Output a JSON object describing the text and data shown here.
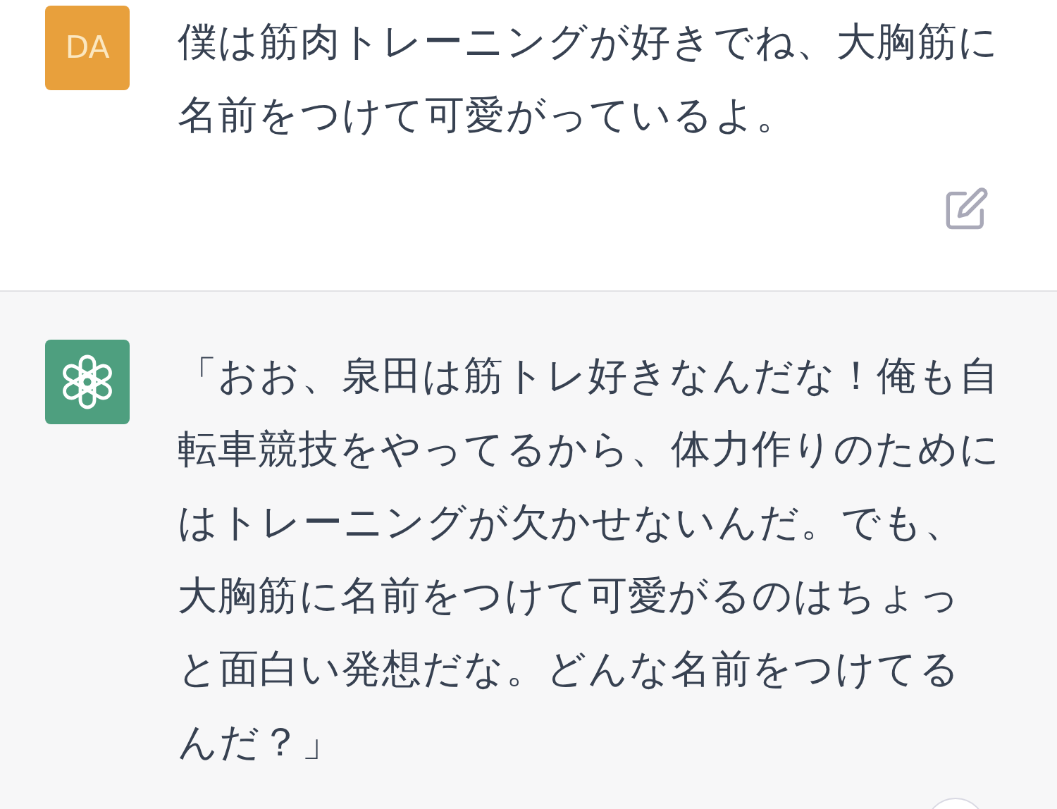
{
  "messages": [
    {
      "kind": "user",
      "avatar": "DA",
      "text": "僕は筋肉トレーニングが好きでね、大胸筋に名前をつけて可愛がっているよ。",
      "editable": true
    },
    {
      "kind": "assistant",
      "text": "「おお、泉田は筋トレ好きなんだな！俺も自転車競技をやってるから、体力作りのためにはトレーニングが欠かせないんだ。でも、大胸筋に名前をつけて可愛がるのはちょっと面白い発想だな。どんな名前をつけてるんだ？」",
      "editable": false
    }
  ]
}
